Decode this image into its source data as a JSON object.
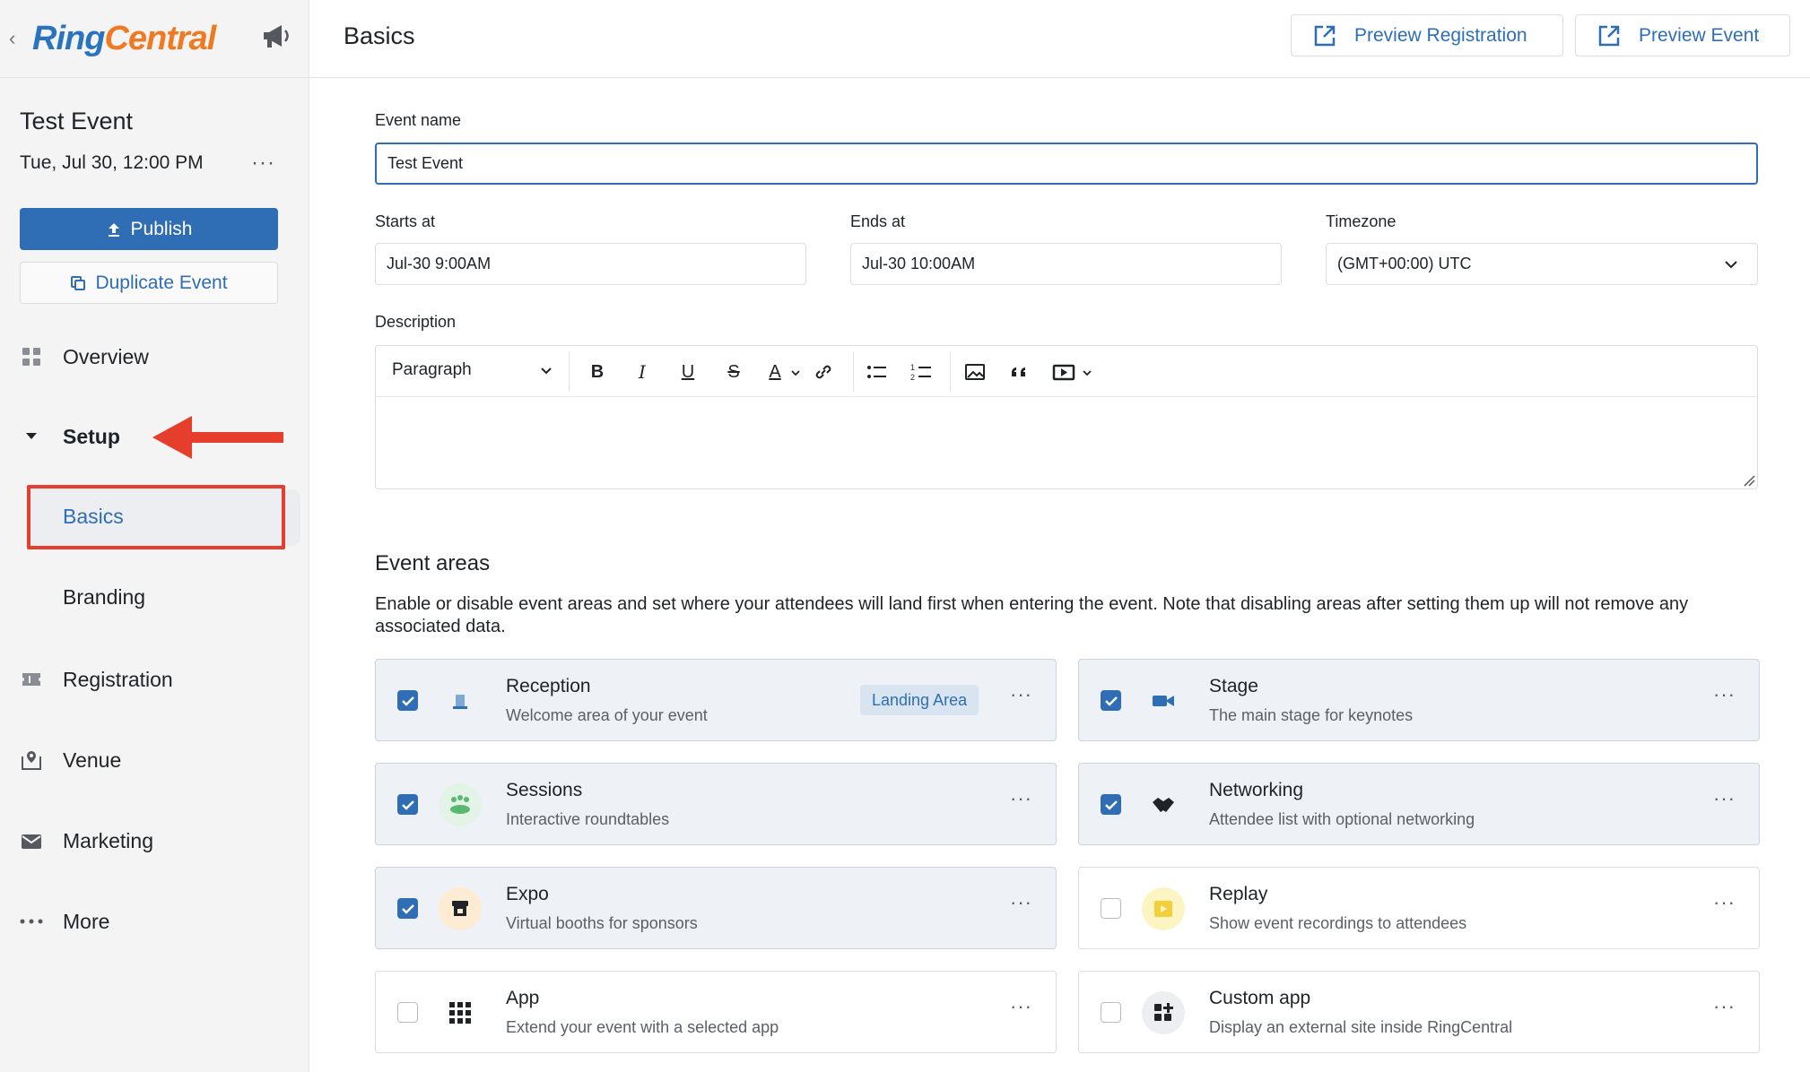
{
  "sidebar": {
    "logo_ring": "Ring",
    "logo_central": "Central",
    "event_title": "Test Event",
    "event_date": "Tue, Jul 30, 12:00 PM",
    "more_glyph": "···",
    "publish_label": "Publish",
    "duplicate_label": "Duplicate Event",
    "nav": {
      "overview": "Overview",
      "setup": "Setup",
      "basics": "Basics",
      "branding": "Branding",
      "registration": "Registration",
      "venue": "Venue",
      "marketing": "Marketing",
      "more": "More"
    }
  },
  "header": {
    "title": "Basics",
    "preview_registration": "Preview Registration",
    "preview_event": "Preview Event"
  },
  "form": {
    "event_name_label": "Event name",
    "event_name_value": "Test Event",
    "starts_label": "Starts at",
    "starts_value": "Jul-30 9:00AM",
    "ends_label": "Ends at",
    "ends_value": "Jul-30 10:00AM",
    "timezone_label": "Timezone",
    "timezone_value": "(GMT+00:00) UTC",
    "description_label": "Description",
    "paragraph_style": "Paragraph"
  },
  "event_areas": {
    "title": "Event areas",
    "description": "Enable or disable event areas and set where your attendees will land first when entering the event. Note that disabling areas after setting them up will not remove any associated data.",
    "landing_badge": "Landing Area",
    "items": [
      {
        "name": "Reception",
        "desc": "Welcome area of your event",
        "checked": true
      },
      {
        "name": "Stage",
        "desc": "The main stage for keynotes",
        "checked": true
      },
      {
        "name": "Sessions",
        "desc": "Interactive roundtables",
        "checked": true
      },
      {
        "name": "Networking",
        "desc": "Attendee list with optional networking",
        "checked": true
      },
      {
        "name": "Expo",
        "desc": "Virtual booths for sponsors",
        "checked": true
      },
      {
        "name": "Replay",
        "desc": "Show event recordings to attendees",
        "checked": false
      },
      {
        "name": "App",
        "desc": "Extend your event with a selected app",
        "checked": false
      },
      {
        "name": "Custom app",
        "desc": "Display an external site inside RingCentral",
        "checked": false
      }
    ]
  },
  "colors": {
    "accent": "#2f6db4",
    "highlight": "#e53e2d",
    "logo_blue": "#2a74bf",
    "logo_orange": "#ef7a22"
  }
}
